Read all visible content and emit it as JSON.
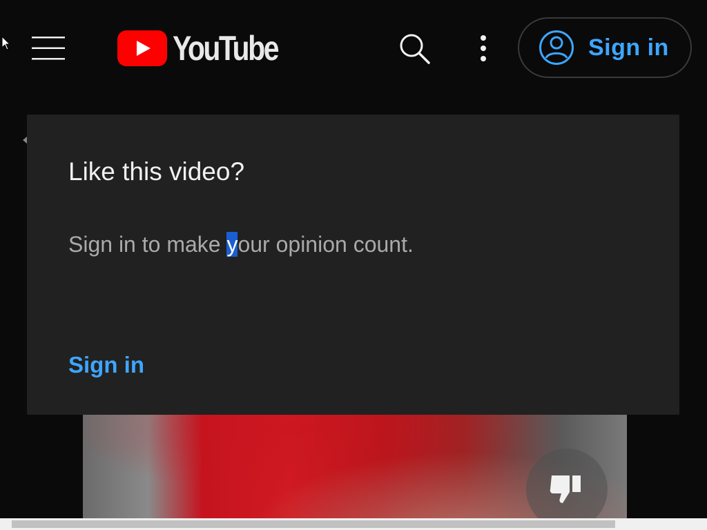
{
  "header": {
    "logo_text": "YouTube",
    "signin_label": "Sign in",
    "icons": {
      "menu": "hamburger-menu-icon",
      "logo": "youtube-play-icon",
      "search": "search-icon",
      "more": "more-vert-icon",
      "account": "account-circle-icon"
    }
  },
  "popup": {
    "title": "Like this video?",
    "body_before": "Sign in to make ",
    "body_selected": "y",
    "body_after": "our opinion count.",
    "signin_link": "Sign in"
  },
  "video": {
    "dislike_icon": "thumb-down-icon"
  },
  "colors": {
    "accent": "#3ea6ff",
    "popup_bg": "#212121",
    "page_bg": "#0a0a0a",
    "logo_red": "#ff0000",
    "selection": "#1a5fd1"
  }
}
